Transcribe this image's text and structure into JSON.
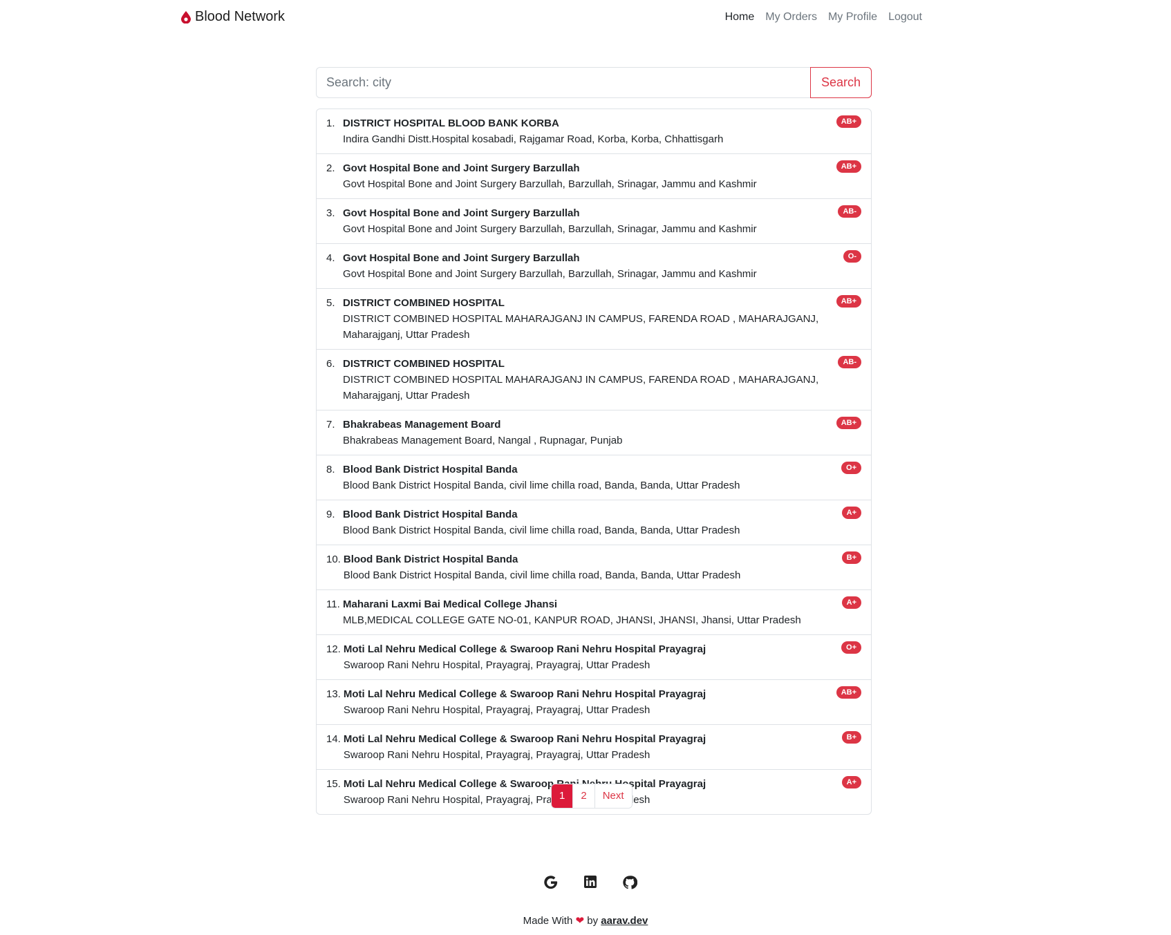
{
  "navbar": {
    "brand": "Blood Network",
    "links": [
      "Home",
      "My Orders",
      "My Profile",
      "Logout"
    ]
  },
  "search": {
    "placeholder": "Search: city",
    "value": "",
    "button_label": "Search"
  },
  "results": [
    {
      "index": "1.",
      "name": "DISTRICT HOSPITAL BLOOD BANK KORBA",
      "address": "Indira Gandhi Distt.Hospital kosabadi, Rajgamar Road, Korba, Korba, Chhattisgarh",
      "blood_group": "AB+"
    },
    {
      "index": "2.",
      "name": "Govt Hospital Bone and Joint Surgery Barzullah",
      "address": "Govt Hospital Bone and Joint Surgery Barzullah, Barzullah, Srinagar, Jammu and Kashmir",
      "blood_group": "AB+"
    },
    {
      "index": "3.",
      "name": "Govt Hospital Bone and Joint Surgery Barzullah",
      "address": "Govt Hospital Bone and Joint Surgery Barzullah, Barzullah, Srinagar, Jammu and Kashmir",
      "blood_group": "AB-"
    },
    {
      "index": "4.",
      "name": "Govt Hospital Bone and Joint Surgery Barzullah",
      "address": "Govt Hospital Bone and Joint Surgery Barzullah, Barzullah, Srinagar, Jammu and Kashmir",
      "blood_group": "O-"
    },
    {
      "index": "5.",
      "name": "DISTRICT COMBINED HOSPITAL",
      "address": "DISTRICT COMBINED HOSPITAL MAHARAJGANJ IN CAMPUS, FARENDA ROAD , MAHARAJGANJ, Maharajganj, Uttar Pradesh",
      "blood_group": "AB+"
    },
    {
      "index": "6.",
      "name": "DISTRICT COMBINED HOSPITAL",
      "address": "DISTRICT COMBINED HOSPITAL MAHARAJGANJ IN CAMPUS, FARENDA ROAD , MAHARAJGANJ, Maharajganj, Uttar Pradesh",
      "blood_group": "AB-"
    },
    {
      "index": "7.",
      "name": "Bhakrabeas Management Board",
      "address": "Bhakrabeas Management Board, Nangal , Rupnagar, Punjab",
      "blood_group": "AB+"
    },
    {
      "index": "8.",
      "name": "Blood Bank District Hospital Banda",
      "address": "Blood Bank District Hospital Banda, civil lime chilla road, Banda, Banda, Uttar Pradesh",
      "blood_group": "O+"
    },
    {
      "index": "9.",
      "name": "Blood Bank District Hospital Banda",
      "address": "Blood Bank District Hospital Banda, civil lime chilla road, Banda, Banda, Uttar Pradesh",
      "blood_group": "A+"
    },
    {
      "index": "10.",
      "name": "Blood Bank District Hospital Banda",
      "address": "Blood Bank District Hospital Banda, civil lime chilla road, Banda, Banda, Uttar Pradesh",
      "blood_group": "B+"
    },
    {
      "index": "11.",
      "name": "Maharani Laxmi Bai Medical College Jhansi",
      "address": "MLB,MEDICAL COLLEGE GATE NO-01, KANPUR ROAD, JHANSI, JHANSI, Jhansi, Uttar Pradesh",
      "blood_group": "A+"
    },
    {
      "index": "12.",
      "name": "Moti Lal Nehru Medical College & Swaroop Rani Nehru Hospital Prayagraj",
      "address": "Swaroop Rani Nehru Hospital, Prayagraj, Prayagraj, Uttar Pradesh",
      "blood_group": "O+"
    },
    {
      "index": "13.",
      "name": "Moti Lal Nehru Medical College & Swaroop Rani Nehru Hospital Prayagraj",
      "address": "Swaroop Rani Nehru Hospital, Prayagraj, Prayagraj, Uttar Pradesh",
      "blood_group": "AB+"
    },
    {
      "index": "14.",
      "name": "Moti Lal Nehru Medical College & Swaroop Rani Nehru Hospital Prayagraj",
      "address": "Swaroop Rani Nehru Hospital, Prayagraj, Prayagraj, Uttar Pradesh",
      "blood_group": "B+"
    },
    {
      "index": "15.",
      "name": "Moti Lal Nehru Medical College & Swaroop Rani Nehru Hospital Prayagraj",
      "address": "Swaroop Rani Nehru Hospital, Prayagraj, Prayagraj, Uttar Pradesh",
      "blood_group": "A+"
    }
  ],
  "pagination": {
    "pages": [
      "1",
      "2"
    ],
    "active": "1",
    "next_label": "Next"
  },
  "footer": {
    "icons": [
      "google-icon",
      "linkedin-icon",
      "github-icon"
    ],
    "made_with": "Made With",
    "by": "by",
    "author": "aarav.dev"
  },
  "colors": {
    "accent": "#dc3545",
    "active_page": "#dc1a3a"
  }
}
